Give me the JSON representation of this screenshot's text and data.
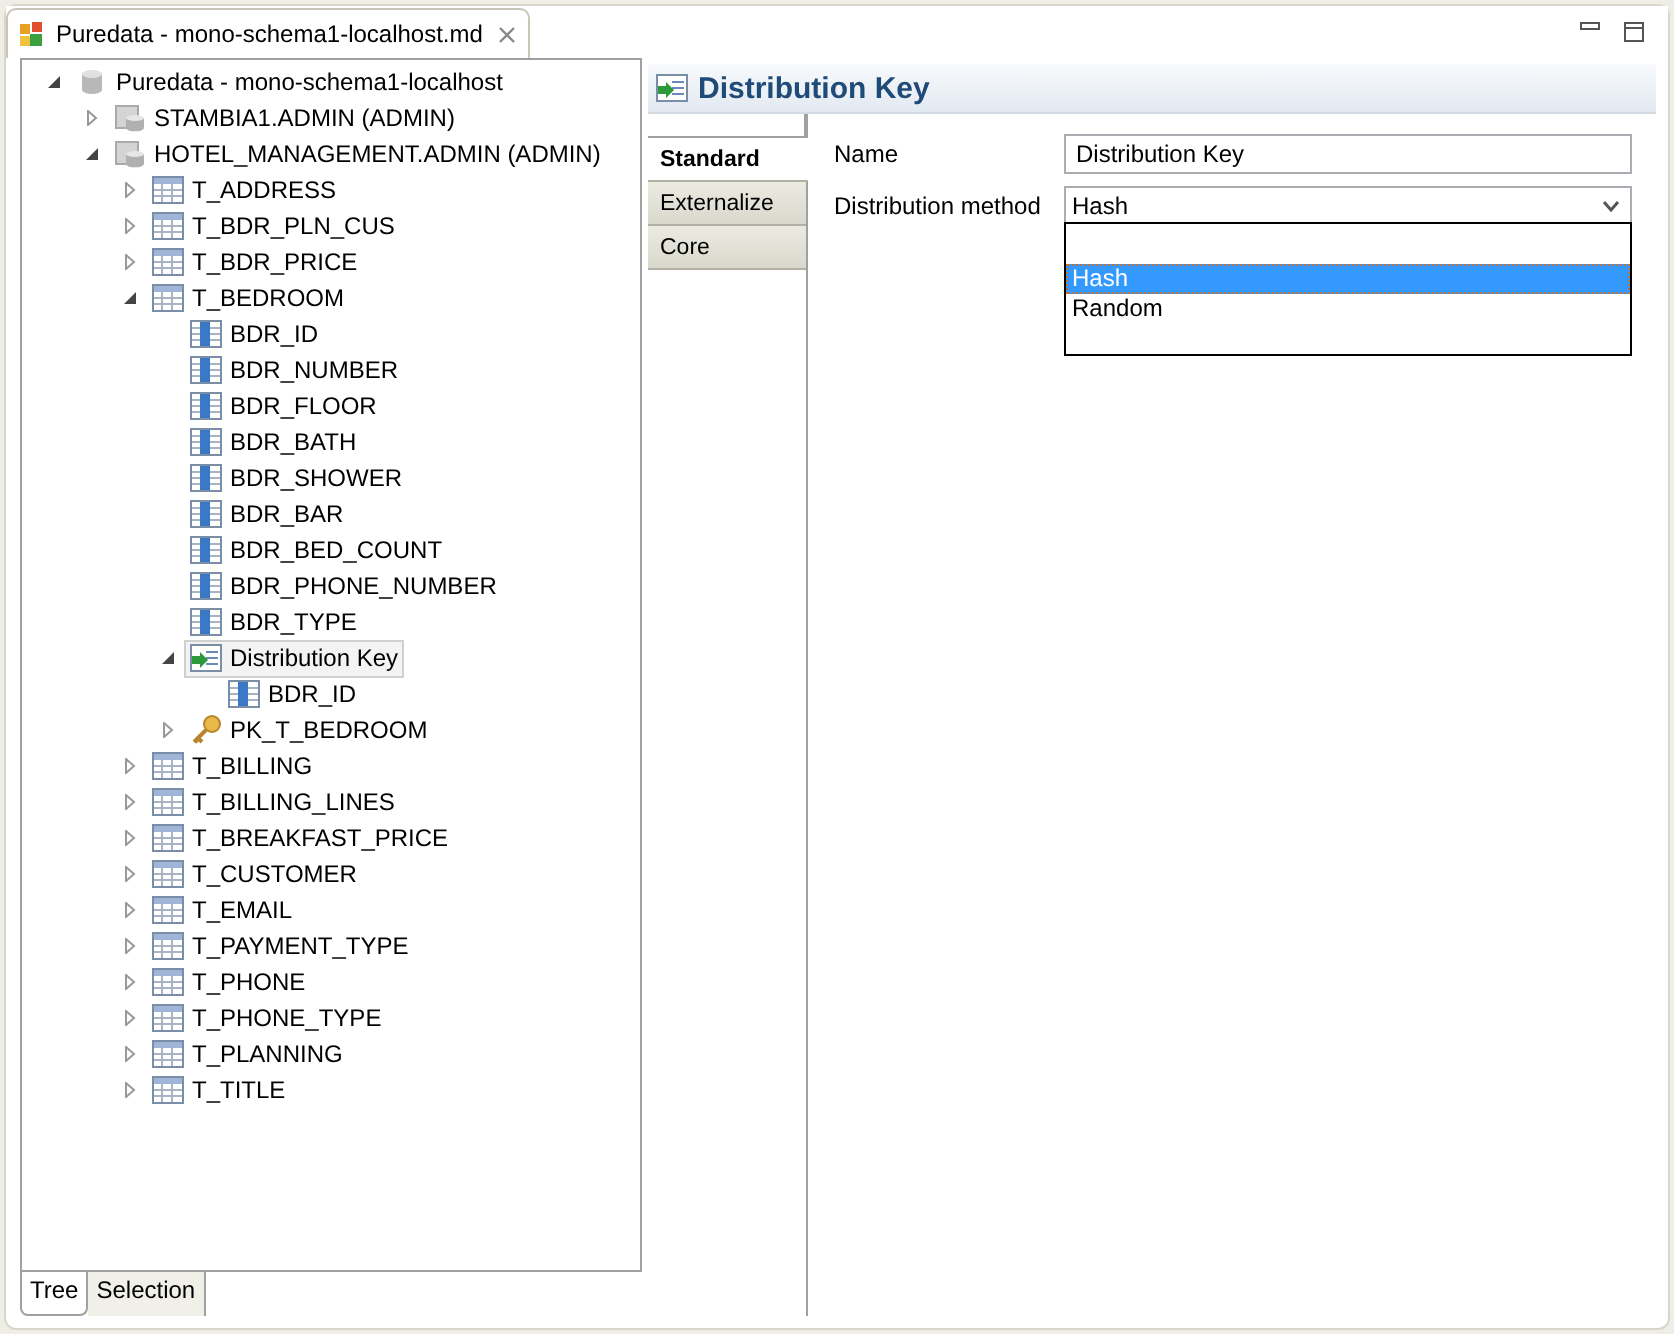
{
  "editor_tab": {
    "title": "Puredata - mono-schema1-localhost.md",
    "selected": true
  },
  "tree": [
    {
      "kind": "database",
      "label": "Puredata - mono-schema1-localhost",
      "expanded": true,
      "selected": false,
      "children": [
        {
          "kind": "schema",
          "label": "STAMBIA1.ADMIN (ADMIN)",
          "expanded": false,
          "selected": false
        },
        {
          "kind": "schema",
          "label": "HOTEL_MANAGEMENT.ADMIN (ADMIN)",
          "expanded": true,
          "selected": false,
          "children": [
            {
              "kind": "table",
              "label": "T_ADDRESS",
              "expanded": false,
              "selected": false
            },
            {
              "kind": "table",
              "label": "T_BDR_PLN_CUS",
              "expanded": false,
              "selected": false
            },
            {
              "kind": "table",
              "label": "T_BDR_PRICE",
              "expanded": false,
              "selected": false
            },
            {
              "kind": "table",
              "label": "T_BEDROOM",
              "expanded": true,
              "selected": false,
              "children": [
                {
                  "kind": "column",
                  "label": "BDR_ID",
                  "selected": false
                },
                {
                  "kind": "column",
                  "label": "BDR_NUMBER",
                  "selected": false
                },
                {
                  "kind": "column",
                  "label": "BDR_FLOOR",
                  "selected": false
                },
                {
                  "kind": "column",
                  "label": "BDR_BATH",
                  "selected": false
                },
                {
                  "kind": "column",
                  "label": "BDR_SHOWER",
                  "selected": false
                },
                {
                  "kind": "column",
                  "label": "BDR_BAR",
                  "selected": false
                },
                {
                  "kind": "column",
                  "label": "BDR_BED_COUNT",
                  "selected": false
                },
                {
                  "kind": "column",
                  "label": "BDR_PHONE_NUMBER",
                  "selected": false
                },
                {
                  "kind": "column",
                  "label": "BDR_TYPE",
                  "selected": false
                },
                {
                  "kind": "distkey",
                  "label": "Distribution Key",
                  "expanded": true,
                  "selected": true,
                  "children": [
                    {
                      "kind": "column",
                      "label": "BDR_ID",
                      "selected": false
                    }
                  ]
                },
                {
                  "kind": "key",
                  "label": "PK_T_BEDROOM",
                  "expanded": false,
                  "selected": false
                }
              ]
            },
            {
              "kind": "table",
              "label": "T_BILLING",
              "expanded": false,
              "selected": false
            },
            {
              "kind": "table",
              "label": "T_BILLING_LINES",
              "expanded": false,
              "selected": false
            },
            {
              "kind": "table",
              "label": "T_BREAKFAST_PRICE",
              "expanded": false,
              "selected": false
            },
            {
              "kind": "table",
              "label": "T_CUSTOMER",
              "expanded": false,
              "selected": false
            },
            {
              "kind": "table",
              "label": "T_EMAIL",
              "expanded": false,
              "selected": false
            },
            {
              "kind": "table",
              "label": "T_PAYMENT_TYPE",
              "expanded": false,
              "selected": false
            },
            {
              "kind": "table",
              "label": "T_PHONE",
              "expanded": false,
              "selected": false
            },
            {
              "kind": "table",
              "label": "T_PHONE_TYPE",
              "expanded": false,
              "selected": false
            },
            {
              "kind": "table",
              "label": "T_PLANNING",
              "expanded": false,
              "selected": false
            },
            {
              "kind": "table",
              "label": "T_TITLE",
              "expanded": false,
              "selected": false
            }
          ]
        }
      ]
    }
  ],
  "bottom_tabs": [
    {
      "label": "Tree",
      "selected": true
    },
    {
      "label": "Selection",
      "selected": false
    }
  ],
  "details": {
    "title": "Distribution Key",
    "side_tabs": [
      {
        "label": "Standard",
        "selected": true
      },
      {
        "label": "Externalize",
        "selected": false
      },
      {
        "label": "Core",
        "selected": false
      }
    ],
    "fields": [
      {
        "kind": "text",
        "label": "Name",
        "value": "Distribution Key"
      },
      {
        "kind": "select",
        "label": "Distribution method",
        "value": "Hash",
        "open": true,
        "options": [
          {
            "kind": "blank"
          },
          {
            "kind": "option",
            "label": "Hash",
            "selected": true
          },
          {
            "kind": "option",
            "label": "Random",
            "selected": false
          }
        ]
      }
    ]
  }
}
